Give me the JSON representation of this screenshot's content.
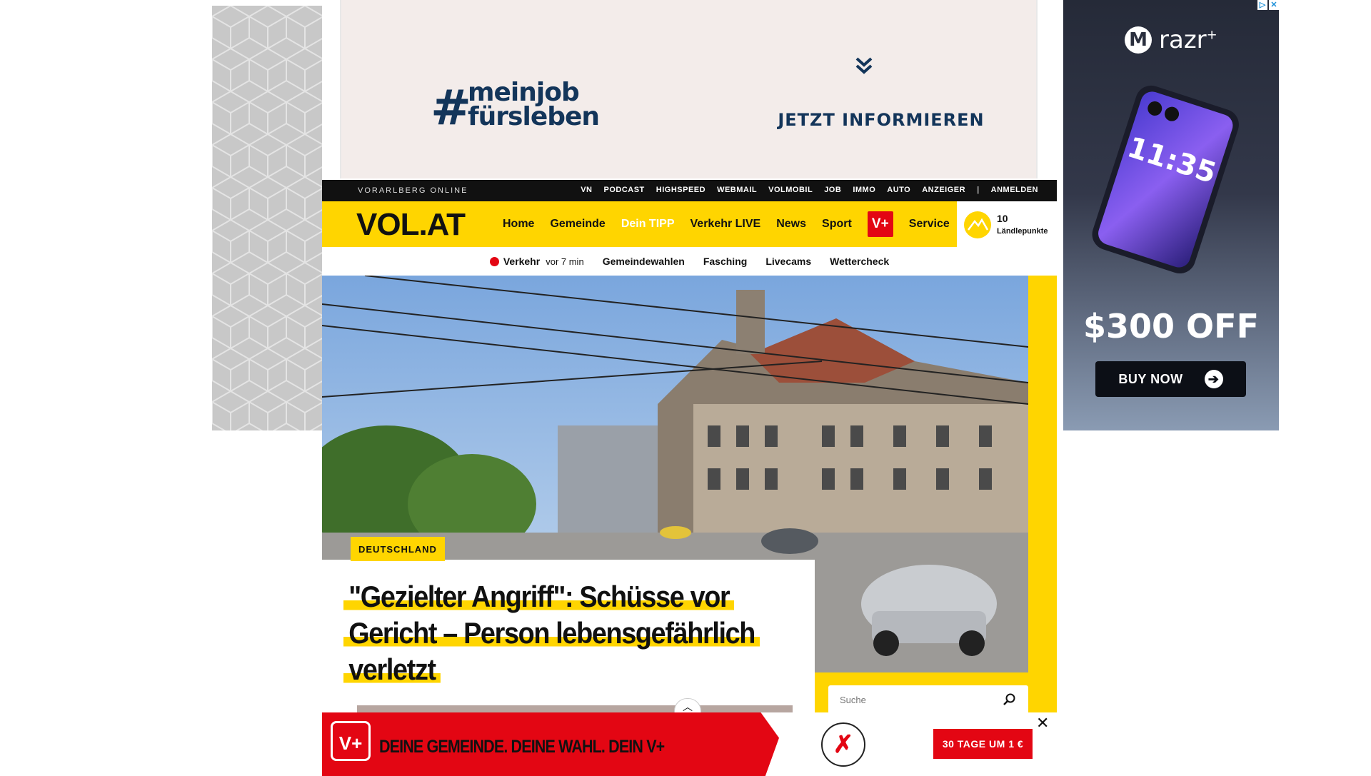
{
  "top_ad": {
    "hashtag_line1": "meinjob",
    "hashtag_line2": "fürsleben",
    "hash": "#",
    "cta": "JETZT INFORMIEREN"
  },
  "right_ad": {
    "adchoices": [
      "▷",
      "✕"
    ],
    "brand": "razr",
    "brand_sup": "+",
    "phone_time": "11:35",
    "offer": "$300 OFF",
    "button": "BUY NOW",
    "button_icon": "arrow-right-icon"
  },
  "topbar": {
    "brand": "VORARLBERG ONLINE",
    "links": [
      "VN",
      "PODCAST",
      "HIGHSPEED",
      "WEBMAIL",
      "VOLMOBIL",
      "JOB",
      "IMMO",
      "AUTO",
      "ANZEIGER",
      "ANMELDEN"
    ],
    "separator": "|"
  },
  "mainnav": {
    "logo": "VOL.AT",
    "items": [
      "Home",
      "Gemeinde",
      "Dein TIPP",
      "Verkehr LIVE",
      "News",
      "Sport"
    ],
    "vplus": "V+",
    "service": "Service",
    "points_value": "10",
    "points_label": "Ländlepunkte"
  },
  "subnav": {
    "live_label": "Verkehr",
    "live_ago": "vor 7 min",
    "items": [
      "Gemeindewahlen",
      "Fasching",
      "Livecams",
      "Wettercheck"
    ]
  },
  "article": {
    "kicker": "DEUTSCHLAND",
    "headline": "\"Gezielter Angriff\": Schüsse vor Gericht – Person lebensgefährlich verletzt"
  },
  "search": {
    "placeholder": "Suche"
  },
  "sticky_ad": {
    "badge": "V+",
    "slogan": "DEINE GEMEINDE. DEINE WAHL. DEIN V+",
    "offer": "30 TAGE UM 1 €",
    "close": "✕"
  },
  "colors": {
    "brand_yellow": "#ffd500",
    "brand_red": "#e30613",
    "ad_navy": "#13355a"
  }
}
